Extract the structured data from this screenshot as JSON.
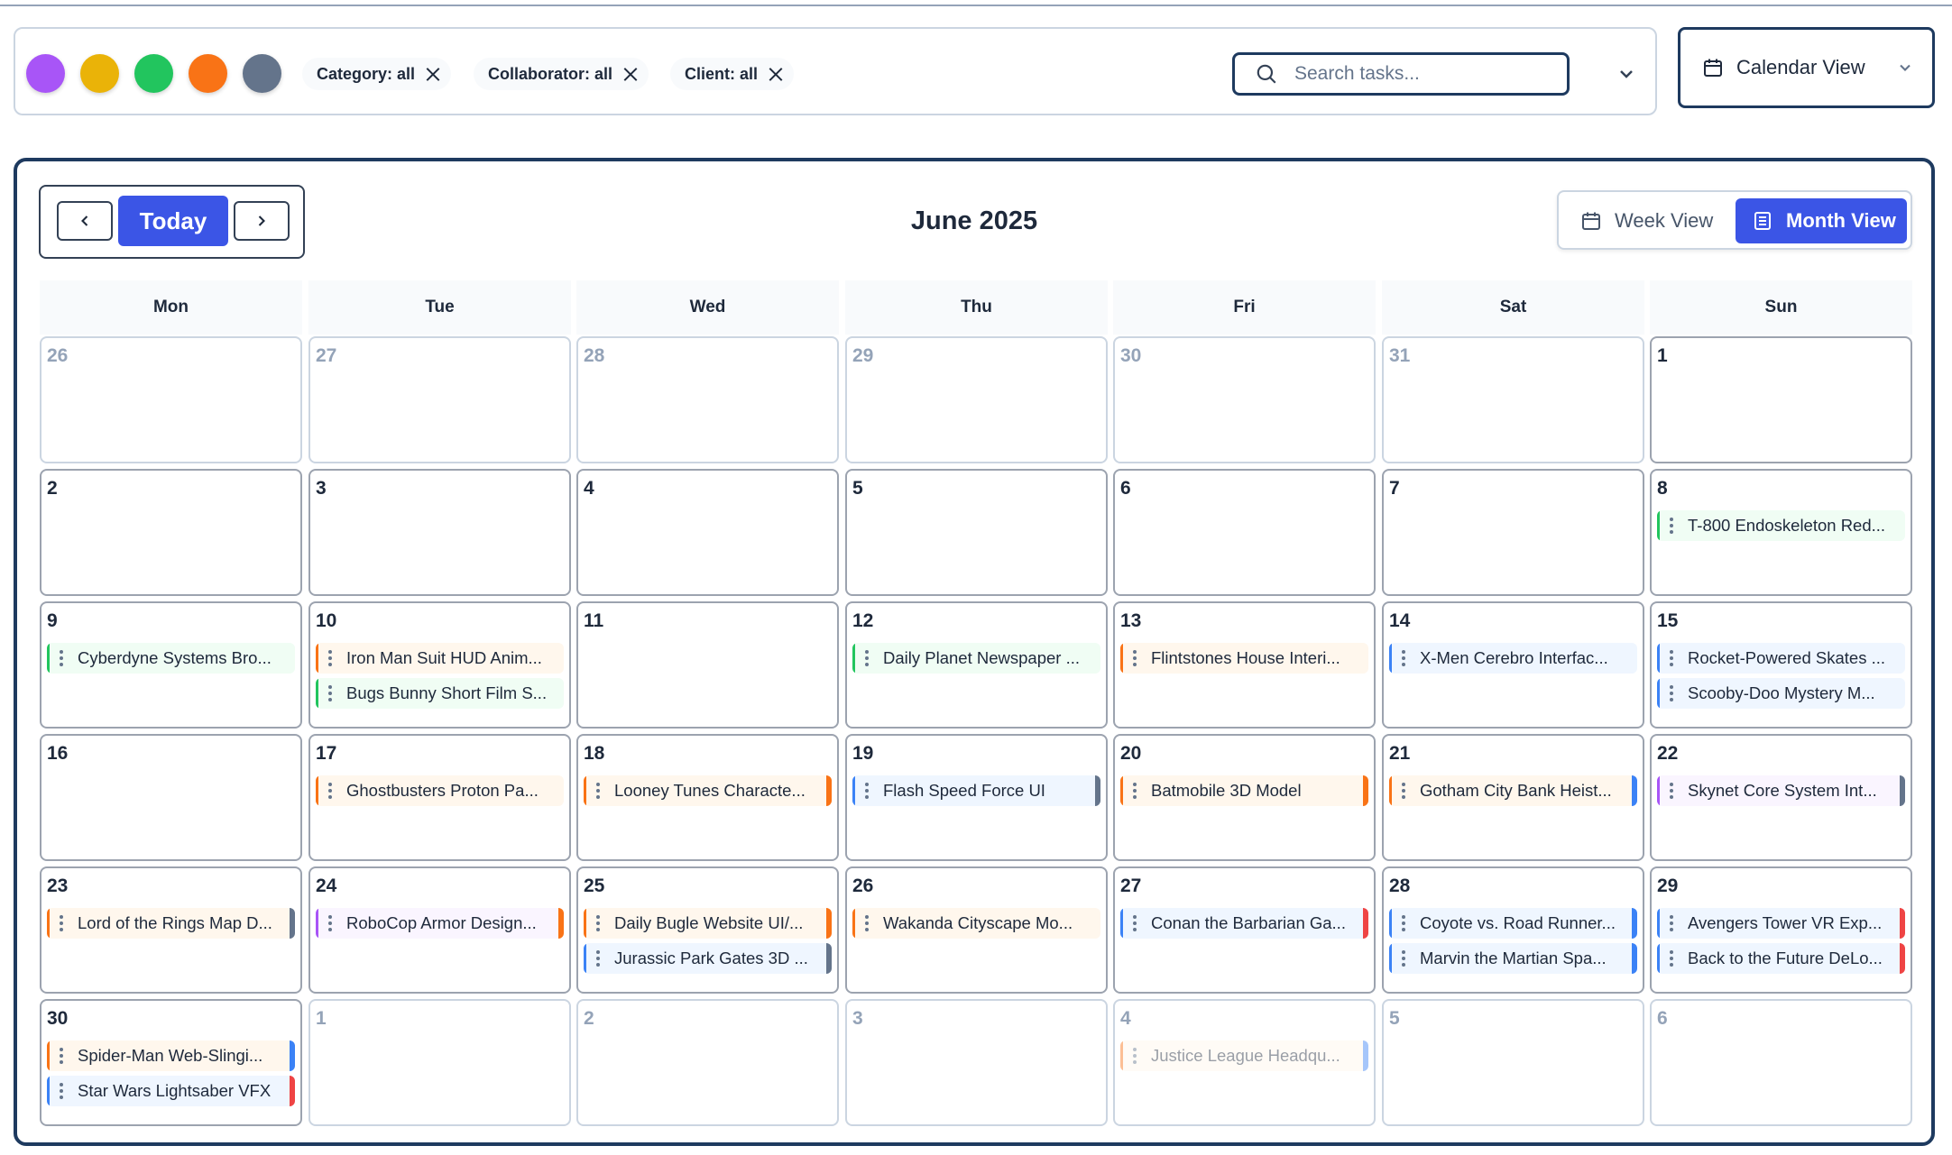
{
  "filters": {
    "color_dots": [
      {
        "name": "purple-filter-dot",
        "color": "#a855f7"
      },
      {
        "name": "yellow-filter-dot",
        "color": "#eab308"
      },
      {
        "name": "green-filter-dot",
        "color": "#22c55e"
      },
      {
        "name": "orange-filter-dot",
        "color": "#f97316"
      },
      {
        "name": "gray-filter-dot",
        "color": "#64748b"
      }
    ],
    "chips": [
      {
        "label": "Category: all"
      },
      {
        "label": "Collaborator: all"
      },
      {
        "label": "Client: all"
      }
    ],
    "search_placeholder": "Search tasks...",
    "search_value": ""
  },
  "view_select": {
    "label": "Calendar View"
  },
  "calendar": {
    "today_label": "Today",
    "title": "June 2025",
    "week_view_label": "Week View",
    "month_view_label": "Month View",
    "weekdays": [
      "Mon",
      "Tue",
      "Wed",
      "Thu",
      "Fri",
      "Sat",
      "Sun"
    ],
    "weeks": [
      [
        {
          "day": "26",
          "other": true,
          "tasks": []
        },
        {
          "day": "27",
          "other": true,
          "tasks": []
        },
        {
          "day": "28",
          "other": true,
          "tasks": []
        },
        {
          "day": "29",
          "other": true,
          "tasks": []
        },
        {
          "day": "30",
          "other": true,
          "tasks": []
        },
        {
          "day": "31",
          "other": true,
          "tasks": []
        },
        {
          "day": "1",
          "other": false,
          "tasks": []
        }
      ],
      [
        {
          "day": "2",
          "other": false,
          "tasks": []
        },
        {
          "day": "3",
          "other": false,
          "tasks": []
        },
        {
          "day": "4",
          "other": false,
          "tasks": []
        },
        {
          "day": "5",
          "other": false,
          "tasks": []
        },
        {
          "day": "6",
          "other": false,
          "tasks": []
        },
        {
          "day": "7",
          "other": false,
          "tasks": []
        },
        {
          "day": "8",
          "other": false,
          "tasks": [
            {
              "title": "T-800 Endoskeleton Red...",
              "left": "#22c55e",
              "bg": "#f0fdf4",
              "right": null
            }
          ]
        }
      ],
      [
        {
          "day": "9",
          "other": false,
          "tasks": [
            {
              "title": "Cyberdyne Systems Bro...",
              "left": "#22c55e",
              "bg": "#f0fdf4",
              "right": null
            }
          ]
        },
        {
          "day": "10",
          "other": false,
          "tasks": [
            {
              "title": "Iron Man Suit HUD Anim...",
              "left": "#f97316",
              "bg": "#fff7ed",
              "right": null
            },
            {
              "title": "Bugs Bunny Short Film S...",
              "left": "#22c55e",
              "bg": "#f0fdf4",
              "right": null
            }
          ]
        },
        {
          "day": "11",
          "other": false,
          "tasks": []
        },
        {
          "day": "12",
          "other": false,
          "tasks": [
            {
              "title": "Daily Planet Newspaper ...",
              "left": "#22c55e",
              "bg": "#f0fdf4",
              "right": null
            }
          ]
        },
        {
          "day": "13",
          "other": false,
          "tasks": [
            {
              "title": "Flintstones House Interi...",
              "left": "#f97316",
              "bg": "#fff7ed",
              "right": null
            }
          ]
        },
        {
          "day": "14",
          "other": false,
          "tasks": [
            {
              "title": "X-Men Cerebro Interfac...",
              "left": "#3b82f6",
              "bg": "#eff6ff",
              "right": null
            }
          ]
        },
        {
          "day": "15",
          "other": false,
          "tasks": [
            {
              "title": "Rocket-Powered Skates ...",
              "left": "#3b82f6",
              "bg": "#eff6ff",
              "right": null
            },
            {
              "title": "Scooby-Doo Mystery M...",
              "left": "#3b82f6",
              "bg": "#eff6ff",
              "right": null
            }
          ]
        }
      ],
      [
        {
          "day": "16",
          "other": false,
          "tasks": []
        },
        {
          "day": "17",
          "other": false,
          "tasks": [
            {
              "title": "Ghostbusters Proton Pa...",
              "left": "#f97316",
              "bg": "#fff7ed",
              "right": null
            }
          ]
        },
        {
          "day": "18",
          "other": false,
          "tasks": [
            {
              "title": "Looney Tunes Characte...",
              "left": "#f97316",
              "bg": "#fff7ed",
              "right": "#f97316"
            }
          ]
        },
        {
          "day": "19",
          "other": false,
          "tasks": [
            {
              "title": "Flash Speed Force UI",
              "left": "#3b82f6",
              "bg": "#eff6ff",
              "right": "#64748b"
            }
          ]
        },
        {
          "day": "20",
          "other": false,
          "tasks": [
            {
              "title": "Batmobile 3D Model",
              "left": "#f97316",
              "bg": "#fff7ed",
              "right": "#f97316"
            }
          ]
        },
        {
          "day": "21",
          "other": false,
          "tasks": [
            {
              "title": "Gotham City Bank Heist...",
              "left": "#f97316",
              "bg": "#fff7ed",
              "right": "#3b82f6"
            }
          ]
        },
        {
          "day": "22",
          "other": false,
          "tasks": [
            {
              "title": "Skynet Core System Int...",
              "left": "#a855f7",
              "bg": "#faf5ff",
              "right": "#64748b"
            }
          ]
        }
      ],
      [
        {
          "day": "23",
          "other": false,
          "tasks": [
            {
              "title": "Lord of the Rings Map D...",
              "left": "#f97316",
              "bg": "#fff7ed",
              "right": "#64748b"
            }
          ]
        },
        {
          "day": "24",
          "other": false,
          "tasks": [
            {
              "title": "RoboCop Armor Design...",
              "left": "#a855f7",
              "bg": "#faf5ff",
              "right": "#f97316"
            }
          ]
        },
        {
          "day": "25",
          "other": false,
          "tasks": [
            {
              "title": "Daily Bugle Website UI/...",
              "left": "#f97316",
              "bg": "#fff7ed",
              "right": "#f97316"
            },
            {
              "title": "Jurassic Park Gates 3D ...",
              "left": "#3b82f6",
              "bg": "#eff6ff",
              "right": "#64748b"
            }
          ]
        },
        {
          "day": "26",
          "other": false,
          "tasks": [
            {
              "title": "Wakanda Cityscape Mo...",
              "left": "#f97316",
              "bg": "#fff7ed",
              "right": null
            }
          ]
        },
        {
          "day": "27",
          "other": false,
          "tasks": [
            {
              "title": "Conan the Barbarian Ga...",
              "left": "#3b82f6",
              "bg": "#eff6ff",
              "right": "#ef4444"
            }
          ]
        },
        {
          "day": "28",
          "other": false,
          "tasks": [
            {
              "title": "Coyote vs. Road Runner...",
              "left": "#3b82f6",
              "bg": "#eff6ff",
              "right": "#3b82f6"
            },
            {
              "title": "Marvin the Martian Spa...",
              "left": "#3b82f6",
              "bg": "#eff6ff",
              "right": "#3b82f6"
            }
          ]
        },
        {
          "day": "29",
          "other": false,
          "tasks": [
            {
              "title": "Avengers Tower VR Exp...",
              "left": "#3b82f6",
              "bg": "#eff6ff",
              "right": "#ef4444"
            },
            {
              "title": "Back to the Future DeLo...",
              "left": "#3b82f6",
              "bg": "#eff6ff",
              "right": "#ef4444"
            }
          ]
        }
      ],
      [
        {
          "day": "30",
          "other": false,
          "tasks": [
            {
              "title": "Spider-Man Web-Slingi...",
              "left": "#f97316",
              "bg": "#fff7ed",
              "right": "#3b82f6"
            },
            {
              "title": "Star Wars Lightsaber VFX",
              "left": "#3b82f6",
              "bg": "#eff6ff",
              "right": "#ef4444"
            }
          ]
        },
        {
          "day": "1",
          "other": true,
          "tasks": []
        },
        {
          "day": "2",
          "other": true,
          "tasks": []
        },
        {
          "day": "3",
          "other": true,
          "tasks": []
        },
        {
          "day": "4",
          "other": true,
          "tasks": [
            {
              "title": "Justice League Headqu...",
              "left": "#f97316",
              "bg": "#fff7ed",
              "right": "#3b82f6",
              "faded": true
            }
          ]
        },
        {
          "day": "5",
          "other": true,
          "tasks": []
        },
        {
          "day": "6",
          "other": true,
          "tasks": []
        }
      ]
    ]
  }
}
